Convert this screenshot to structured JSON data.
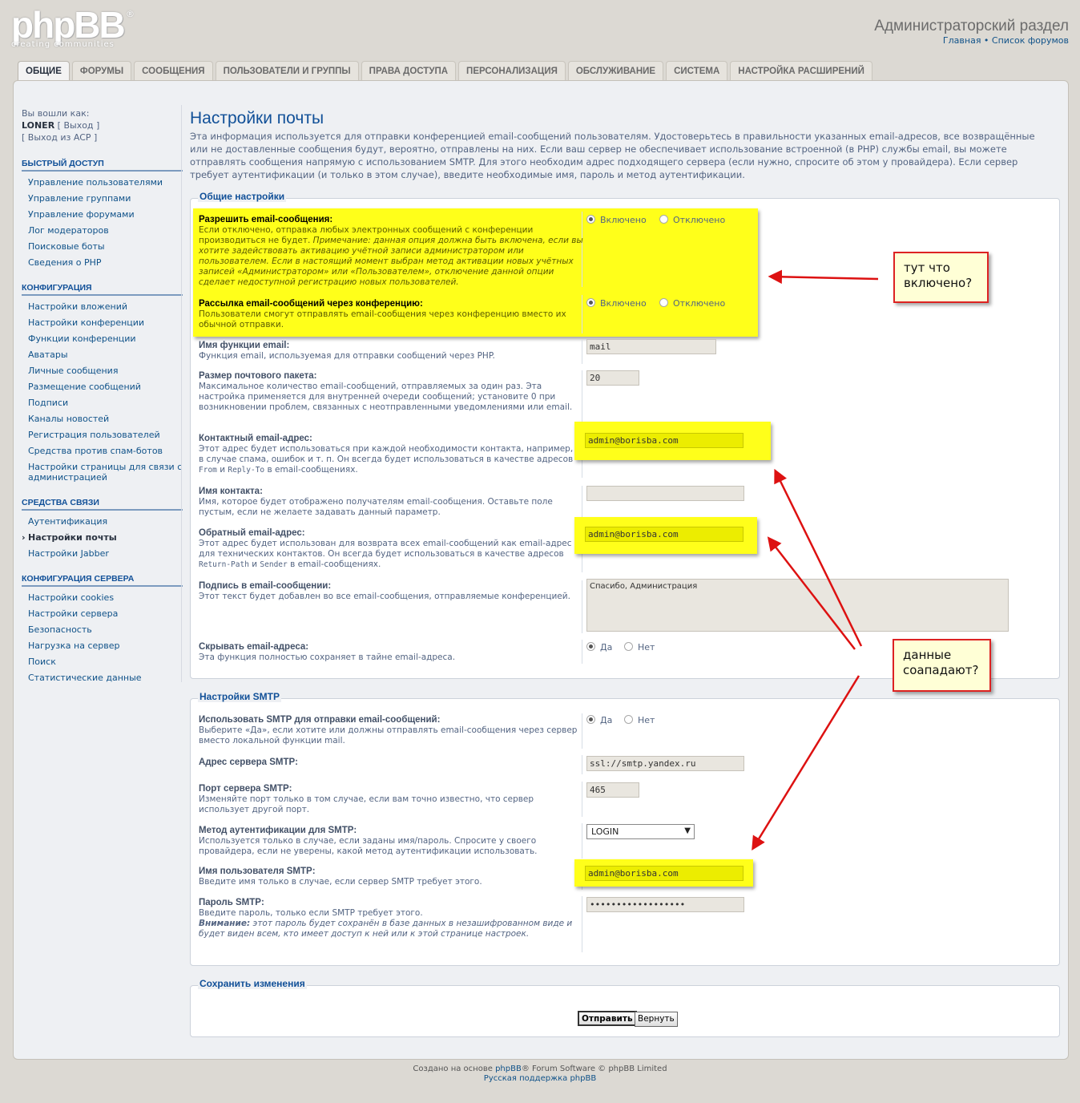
{
  "header": {
    "logo_text": "phpBB",
    "logo_sub": "creating    communities",
    "logo_reg": "®",
    "acp_title": "Администраторский раздел",
    "link_home": "Главная",
    "link_sep": " • ",
    "link_forums": "Список форумов"
  },
  "tabs": [
    "ОБЩИЕ",
    "ФОРУМЫ",
    "СООБЩЕНИЯ",
    "ПОЛЬЗОВАТЕЛИ И ГРУППЫ",
    "ПРАВА ДОСТУПА",
    "ПЕРСОНАЛИЗАЦИЯ",
    "ОБСЛУЖИВАНИЕ",
    "СИСТЕМА",
    "НАСТРОЙКА РАСШИРЕНИЙ"
  ],
  "sidebar": {
    "logged_as": "Вы вошли как:",
    "user": "LONER",
    "logout": "[ Выход ]",
    "exit_acp": "[ Выход из ACP ]",
    "sections": [
      {
        "title": "БЫСТРЫЙ ДОСТУП",
        "items": [
          "Управление пользователями",
          "Управление группами",
          "Управление форумами",
          "Лог модераторов",
          "Поисковые боты",
          "Сведения о PHP"
        ]
      },
      {
        "title": "КОНФИГУРАЦИЯ",
        "items": [
          "Настройки вложений",
          "Настройки конференции",
          "Функции конференции",
          "Аватары",
          "Личные сообщения",
          "Размещение сообщений",
          "Подписи",
          "Каналы новостей",
          "Регистрация пользователей",
          "Средства против спам-ботов",
          "Настройки страницы для связи с администрацией"
        ]
      },
      {
        "title": "СРЕДСТВА СВЯЗИ",
        "items": [
          "Аутентификация",
          "Настройки почты",
          "Настройки Jabber"
        ]
      },
      {
        "title": "КОНФИГУРАЦИЯ СЕРВЕРА",
        "items": [
          "Настройки cookies",
          "Настройки сервера",
          "Безопасность",
          "Нагрузка на сервер",
          "Поиск",
          "Статистические данные"
        ]
      }
    ]
  },
  "main": {
    "title": "Настройки почты",
    "intro": "Эта информация используется для отправки конференцией email-сообщений пользователям. Удостоверьтесь в правильности указанных email-адресов, все возвращённые или не доставленные сообщения будут, вероятно, отправлены на них. Если ваш сервер не обеспечивает использование встроенной (в PHP) службы email, вы можете отправлять сообщения напрямую с использованием SMTP. Для этого необходим адрес подходящего сервера (если нужно, спросите об этом у провайдера). Если сервер требует аутентификации (и только в этом случае), введите необходимые имя, пароль и метод аутентификации."
  },
  "general": {
    "legend": "Общие настройки",
    "enable_label": "Разрешить email-сообщения:",
    "enable_exp": "Если отключено, отправка любых электронных сообщений с конференции производиться не будет.",
    "enable_note": "Примечание: данная опция должна быть включена, если вы хотите задействовать активацию учётной записи администратором или пользователем. Если в настоящий момент выбран метод активации новых учётных записей «Администратором» или «Пользователем», отключение данной опции сделает недоступной регистрацию новых пользователей.",
    "on": "Включено",
    "off": "Отключено",
    "board_label": "Рассылка email-сообщений через конференцию:",
    "board_exp": "Пользователи смогут отправлять email-сообщения через конференцию вместо их обычной отправки.",
    "func_label": "Имя функции email:",
    "func_exp": "Функция email, используемая для отправки сообщений через PHP.",
    "func_value": "mail",
    "pkg_label": "Размер почтового пакета:",
    "pkg_exp": "Максимальное количество email-сообщений, отправляемых за один раз. Эта настройка применяется для внутренней очереди сообщений; установите 0 при возникновении проблем, связанных с неотправленными уведомлениями или email.",
    "pkg_value": "20",
    "contact_label": "Контактный email-адрес:",
    "contact_exp_1": "Этот адрес будет использоваться при каждой необходимости контакта, например, в случае спама, ошибок и т. п. Он всегда будет использоваться в качестве адресов ",
    "contact_code_1": "From",
    "contact_exp_2": " и ",
    "contact_code_2": "Reply-To",
    "contact_exp_3": " в email-сообщениях.",
    "contact_value": "admin@borisba.com",
    "cname_label": "Имя контакта:",
    "cname_exp": "Имя, которое будет отображено получателям email-сообщения. Оставьте поле пустым, если не желаете задавать данный параметр.",
    "cname_value": "",
    "return_label": "Обратный email-адрес:",
    "return_exp_1": "Этот адрес будет использован для возврата всех email-сообщений как email-адрес для технических контактов. Он всегда будет использоваться в качестве адресов ",
    "return_code_1": "Return-Path",
    "return_exp_2": " и ",
    "return_code_2": "Sender",
    "return_exp_3": " в email-сообщениях.",
    "return_value": "admin@borisba.com",
    "sig_label": "Подпись в email-сообщении:",
    "sig_exp": "Этот текст будет добавлен во все email-сообщения, отправляемые конференцией.",
    "sig_value": "Спасибо, Администрация",
    "hide_label": "Скрывать email-адреса:",
    "hide_exp": "Эта функция полностью сохраняет в тайне email-адреса.",
    "yes": "Да",
    "no": "Нет"
  },
  "smtp": {
    "legend": "Настройки SMTP",
    "use_label": "Использовать SMTP для отправки email-сообщений:",
    "use_exp": "Выберите «Да», если хотите или должны отправлять email-сообщения через сервер вместо локальной функции mail.",
    "host_label": "Адрес сервера SMTP:",
    "host_value": "ssl://smtp.yandex.ru",
    "port_label": "Порт сервера SMTP:",
    "port_exp": "Изменяйте порт только в том случае, если вам точно известно, что сервер использует другой порт.",
    "port_value": "465",
    "auth_label": "Метод аутентификации для SMTP:",
    "auth_exp": "Используется только в случае, если заданы имя/пароль. Спросите у своего провайдера, если не уверены, какой метод аутентификации использовать.",
    "auth_value": "LOGIN",
    "user_label": "Имя пользователя SMTP:",
    "user_exp": "Введите имя только в случае, если сервер SMTP требует этого.",
    "user_value": "admin@borisba.com",
    "pass_label": "Пароль SMTP:",
    "pass_exp": "Введите пароль, только если SMTP требует этого.",
    "pass_warn": "Внимание:",
    "pass_warn_text": " этот пароль будет сохранён в базе данных в незашифрованном виде и будет виден всем, кто имеет доступ к ней или к этой странице настроек.",
    "pass_value": "••••••••••••••••••"
  },
  "save": {
    "legend": "Сохранить изменения",
    "submit": "Отправить",
    "reset": "Вернуть"
  },
  "annotations": {
    "note1": "тут что\nвключено?",
    "note2": "данные\nсоападают?",
    "arrow_color": "#dd1111",
    "highlight_color": "#ffff1a"
  },
  "footer": {
    "line1_a": "Создано на основе ",
    "line1_b": "phpBB",
    "line1_c": "® Forum Software © phpBB Limited",
    "line2": "Русская поддержка phpBB"
  }
}
